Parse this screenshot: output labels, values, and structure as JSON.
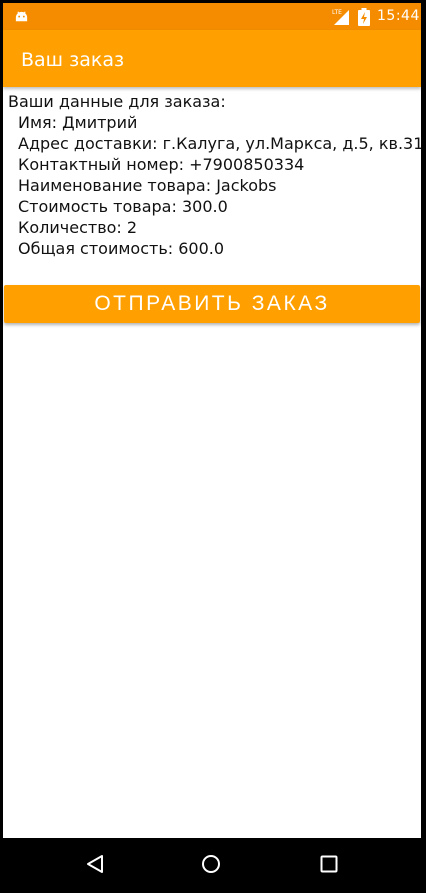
{
  "status_bar": {
    "time": "15:44",
    "network_label": "LTE",
    "icons": [
      "android-icon",
      "lte-signal-icon",
      "battery-charging-icon"
    ]
  },
  "toolbar": {
    "title": "Ваш заказ"
  },
  "order": {
    "intro": "Ваши данные для заказа:",
    "details": [
      "Имя: Дмитрий",
      "Адрес доставки: г.Калуга, ул.Маркса, д.5, кв.31",
      "Контактный номер: +7900850334",
      "Наименование товара: Jackobs",
      "Стоимость товара: 300.0",
      "Количество: 2",
      "Общая стоимость: 600.0"
    ]
  },
  "submit": {
    "label": "ОТПРАВИТЬ ЗАКАЗ"
  },
  "nav": {
    "icons": [
      "back-icon",
      "home-icon",
      "recents-icon"
    ]
  },
  "colors": {
    "status_bar": "#F58C00",
    "toolbar": "#FFA000",
    "button": "#FFA000",
    "background": "#FFFFFF",
    "text": "#111111"
  }
}
